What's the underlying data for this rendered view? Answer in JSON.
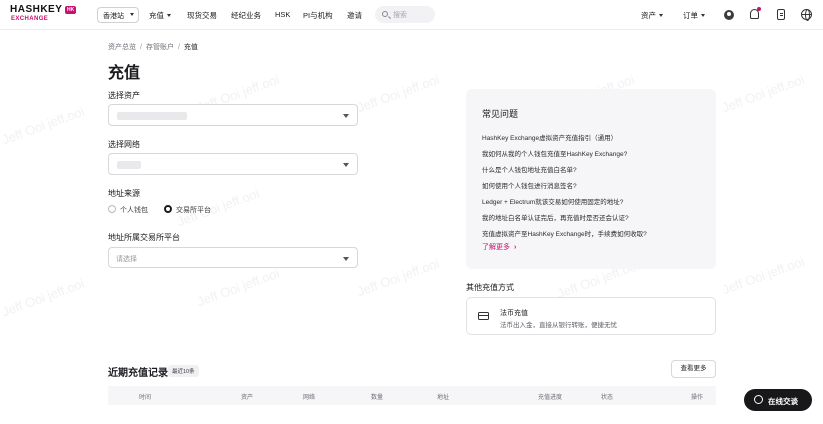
{
  "brand": {
    "name": "HASHKEY",
    "sub": "EXCHANGE",
    "badge": "HK"
  },
  "header": {
    "site": "香港站",
    "nav": [
      {
        "label": "充值",
        "dropdown": true
      },
      {
        "label": "现货交易",
        "dropdown": false
      },
      {
        "label": "经纪业务",
        "dropdown": false
      },
      {
        "label": "HSK",
        "dropdown": false
      },
      {
        "label": "PI与机构",
        "dropdown": false
      },
      {
        "label": "邀请",
        "dropdown": false
      }
    ],
    "search_placeholder": "搜索",
    "assets": "资产",
    "orders": "订单"
  },
  "breadcrumb": [
    "资产总览",
    "存管账户",
    "充值"
  ],
  "page_title": "充值",
  "form": {
    "asset_label": "选择资产",
    "network_label": "选择网络",
    "source_label": "地址来源",
    "source_options": [
      {
        "label": "个人钱包",
        "selected": false
      },
      {
        "label": "交易所平台",
        "selected": true
      }
    ],
    "platform_label": "地址所属交易所平台",
    "platform_placeholder": "请选择"
  },
  "faq": {
    "title": "常见问题",
    "items": [
      "HashKey Exchange虚拟资产充值指引（通用）",
      "我如何从我的个人钱包充值至HashKey Exchange?",
      "什么是个人钱包地址充值白名单?",
      "如何使用个人钱包进行消息签名?",
      "Ledger + Electrum就该交易如何使用固定的地址?",
      "我的地址白名单认证完后，再充值时是否还会认证?",
      "充值虚拟资产至HashKey Exchange时，手续费如何收取?"
    ],
    "more": "了解更多"
  },
  "other_methods": {
    "title": "其他充值方式",
    "fiat_name": "法币充值",
    "fiat_desc": "法币出入金，直接从银行转账，便捷无忧"
  },
  "records": {
    "title": "近期充值记录",
    "badge": "最近10条",
    "view_more": "查看更多",
    "columns": [
      "时间",
      "资产",
      "网络",
      "数量",
      "地址",
      "充值进度",
      "状态",
      "操作"
    ]
  },
  "watermark": "Jeff Ooi jeff.ooi",
  "chat": {
    "label": "在线交谈"
  },
  "colors": {
    "accent": "#c8116e",
    "dark": "#18181b"
  }
}
